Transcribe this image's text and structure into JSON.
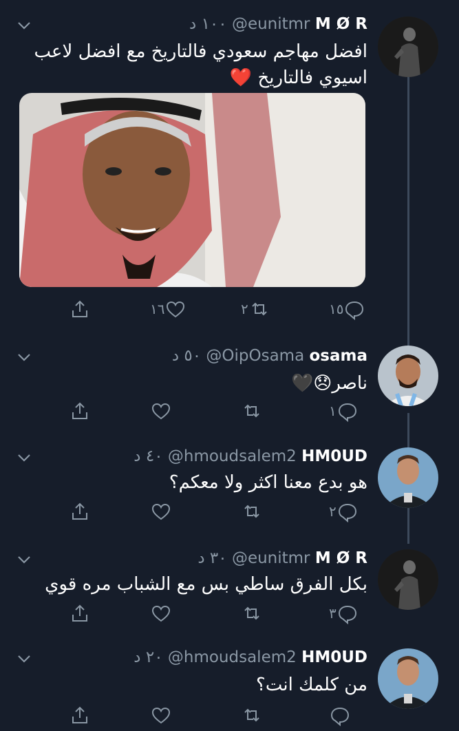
{
  "tweets": [
    {
      "name": "M Ø R",
      "handle": "@eunitmr",
      "time": "١٠٠ د",
      "text": "افضل مهاجم سعودي فالتاريخ مع افضل لاعب اسيوي فالتاريخ ❤️",
      "counts": {
        "reply": "١٥",
        "retweet": "٢",
        "like": "١٦"
      },
      "has_media": true,
      "avatar": "dark-figure"
    },
    {
      "name": "osama",
      "handle": "@OipOsama",
      "time": "٥٠ د",
      "text": "ناصر😞🖤",
      "counts": {
        "reply": "١",
        "retweet": "",
        "like": ""
      },
      "avatar": "player-argentina"
    },
    {
      "name": "HM0UD",
      "handle": "@hmoudsalem2",
      "time": "٤٠ د",
      "text": "هو بدع معنا اكثر ولا معكم؟",
      "counts": {
        "reply": "٢",
        "retweet": "",
        "like": ""
      },
      "avatar": "player-messi"
    },
    {
      "name": "M Ø R",
      "handle": "@eunitmr",
      "time": "٣٠ د",
      "text": "بكل الفرق ساطي بس مع الشباب مره قوي",
      "counts": {
        "reply": "٣",
        "retweet": "",
        "like": ""
      },
      "avatar": "dark-figure"
    },
    {
      "name": "HM0UD",
      "handle": "@hmoudsalem2",
      "time": "٢٠ د",
      "text": "من كلمك انت؟",
      "counts": {
        "reply": "",
        "retweet": "",
        "like": ""
      },
      "avatar": "player-messi"
    }
  ]
}
